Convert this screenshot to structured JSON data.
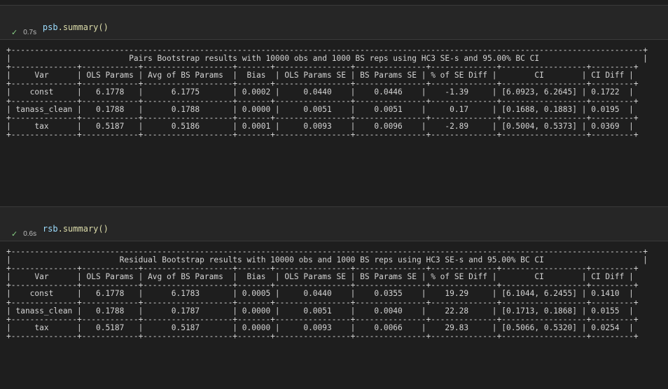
{
  "cells": [
    {
      "code": {
        "var": "psb",
        "call": ".summary()"
      },
      "status": {
        "icon": "check-icon",
        "time": "0.7s"
      },
      "output_lines": [
        "+--------------------------------------------------------------------------------------------------------------------------------------+",
        "|                         Pairs Bootstrap results with 10000 obs and 1000 BS reps using HC3 SE-s and 95.00% BC CI                      |",
        "+--------------+------------+-------------------+-------+----------------+---------------+--------------+------------------+---------+",
        "|     Var      | OLS Params | Avg of BS Params  |  Bias  | OLS Params SE | BS Params SE | % of SE Diff |        CI        | CI Diff |",
        "+--------------+------------+-------------------+-------+----------------+---------------+--------------+------------------+---------+",
        "|    const     |   6.1778   |      6.1775       | 0.0002 |     0.0440    |    0.0446    |    -1.39     | [6.0923, 6.2645] | 0.1722  |",
        "+--------------+------------+-------------------+-------+----------------+---------------+--------------+------------------+---------+",
        "| tanass_clean |   0.1788   |      0.1788       | 0.0000 |     0.0051    |    0.0051    |     0.17     | [0.1688, 0.1883] | 0.0195  |",
        "+--------------+------------+-------------------+-------+----------------+---------------+--------------+------------------+---------+",
        "|     tax      |   0.5187   |      0.5186       | 0.0001 |     0.0093    |    0.0096    |    -2.89     | [0.5004, 0.5373] | 0.0369  |",
        "+--------------+------------+-------------------+-------+----------------+---------------+--------------+------------------+---------+"
      ]
    },
    {
      "code": {
        "var": "rsb",
        "call": ".summary()"
      },
      "status": {
        "icon": "check-icon",
        "time": "0.6s"
      },
      "output_lines": [
        "+--------------------------------------------------------------------------------------------------------------------------------------+",
        "|                       Residual Bootstrap results with 10000 obs and 1000 BS reps using HC3 SE-s and 95.00% BC CI                     |",
        "+--------------+------------+-------------------+-------+----------------+---------------+--------------+------------------+---------+",
        "|     Var      | OLS Params | Avg of BS Params  |  Bias  | OLS Params SE | BS Params SE | % of SE Diff |        CI        | CI Diff |",
        "+--------------+------------+-------------------+-------+----------------+---------------+--------------+------------------+---------+",
        "|    const     |   6.1778   |      6.1783       | 0.0005 |     0.0440    |    0.0355    |    19.29     | [6.1044, 6.2455] | 0.1410  |",
        "+--------------+------------+-------------------+-------+----------------+---------------+--------------+------------------+---------+",
        "| tanass_clean |   0.1788   |      0.1787       | 0.0000 |     0.0051    |    0.0040    |    22.28     | [0.1713, 0.1868] | 0.0155  |",
        "+--------------+------------+-------------------+-------+----------------+---------------+--------------+------------------+---------+",
        "|     tax      |   0.5187   |      0.5187       | 0.0000 |     0.0093    |    0.0066    |    29.83     | [0.5066, 0.5320] | 0.0254  |",
        "+--------------+------------+-------------------+-------+----------------+---------------+--------------+------------------+---------+"
      ]
    }
  ]
}
